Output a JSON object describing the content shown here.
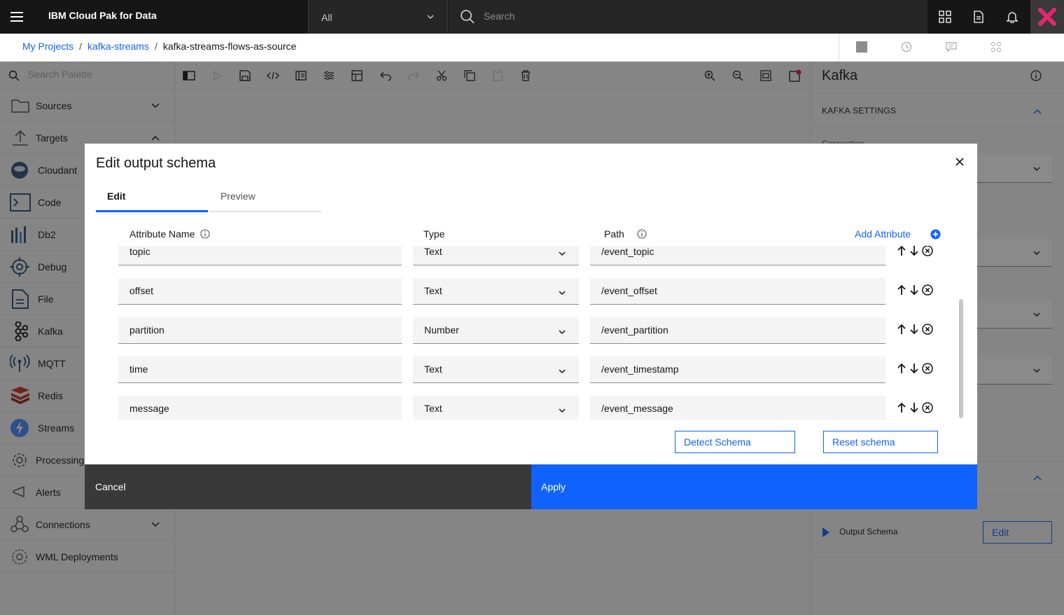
{
  "topbar": {
    "brand": "IBM Cloud Pak for Data",
    "scope": "All",
    "search_placeholder": "Search"
  },
  "breadcrumb": {
    "items": [
      "My Projects",
      "kafka-streams"
    ],
    "current": "kafka-streams-flows-as-source"
  },
  "palette": {
    "search_placeholder": "Search Palette",
    "items": [
      {
        "label": "Sources",
        "icon": "folder-icon"
      },
      {
        "label": "Targets",
        "icon": "upload-icon"
      },
      {
        "label": "Cloudant",
        "icon": "cloudant-icon"
      },
      {
        "label": "Code",
        "icon": "terminal-icon"
      },
      {
        "label": "Db2",
        "icon": "db2-icon"
      },
      {
        "label": "Debug",
        "icon": "crosshair-icon"
      },
      {
        "label": "File",
        "icon": "document-icon"
      },
      {
        "label": "Kafka",
        "icon": "kafka-icon"
      },
      {
        "label": "MQTT",
        "icon": "antenna-icon"
      },
      {
        "label": "Redis",
        "icon": "redis-icon"
      },
      {
        "label": "Streams",
        "icon": "streams-icon"
      },
      {
        "label": "Processing",
        "icon": "settings-icon"
      },
      {
        "label": "Alerts",
        "icon": "megaphone-icon"
      },
      {
        "label": "Connections",
        "icon": "connections-icon"
      },
      {
        "label": "WML Deployments",
        "icon": "wml-icon"
      }
    ]
  },
  "right_panel": {
    "title": "Kafka",
    "section": "KAFKA SETTINGS",
    "connection_label": "Connection",
    "output_schema_label": "Output Schema",
    "edit_label": "Edit"
  },
  "modal": {
    "title": "Edit output schema",
    "tabs": [
      "Edit",
      "Preview"
    ],
    "headers": {
      "name": "Attribute Name",
      "type": "Type",
      "path": "Path"
    },
    "add_attribute": "Add Attribute",
    "rows": [
      {
        "name": "topic",
        "type": "Text",
        "path": "/event_topic"
      },
      {
        "name": "offset",
        "type": "Text",
        "path": "/event_offset"
      },
      {
        "name": "partition",
        "type": "Number",
        "path": "/event_partition"
      },
      {
        "name": "time",
        "type": "Text",
        "path": "/event_timestamp"
      },
      {
        "name": "message",
        "type": "Text",
        "path": "/event_message"
      }
    ],
    "detect_schema": "Detect Schema",
    "reset_schema": "Reset schema",
    "cancel": "Cancel",
    "apply": "Apply"
  },
  "colors": {
    "accent": "#0f62fe",
    "topbar": "#161616",
    "cancel_bg": "#393939"
  }
}
